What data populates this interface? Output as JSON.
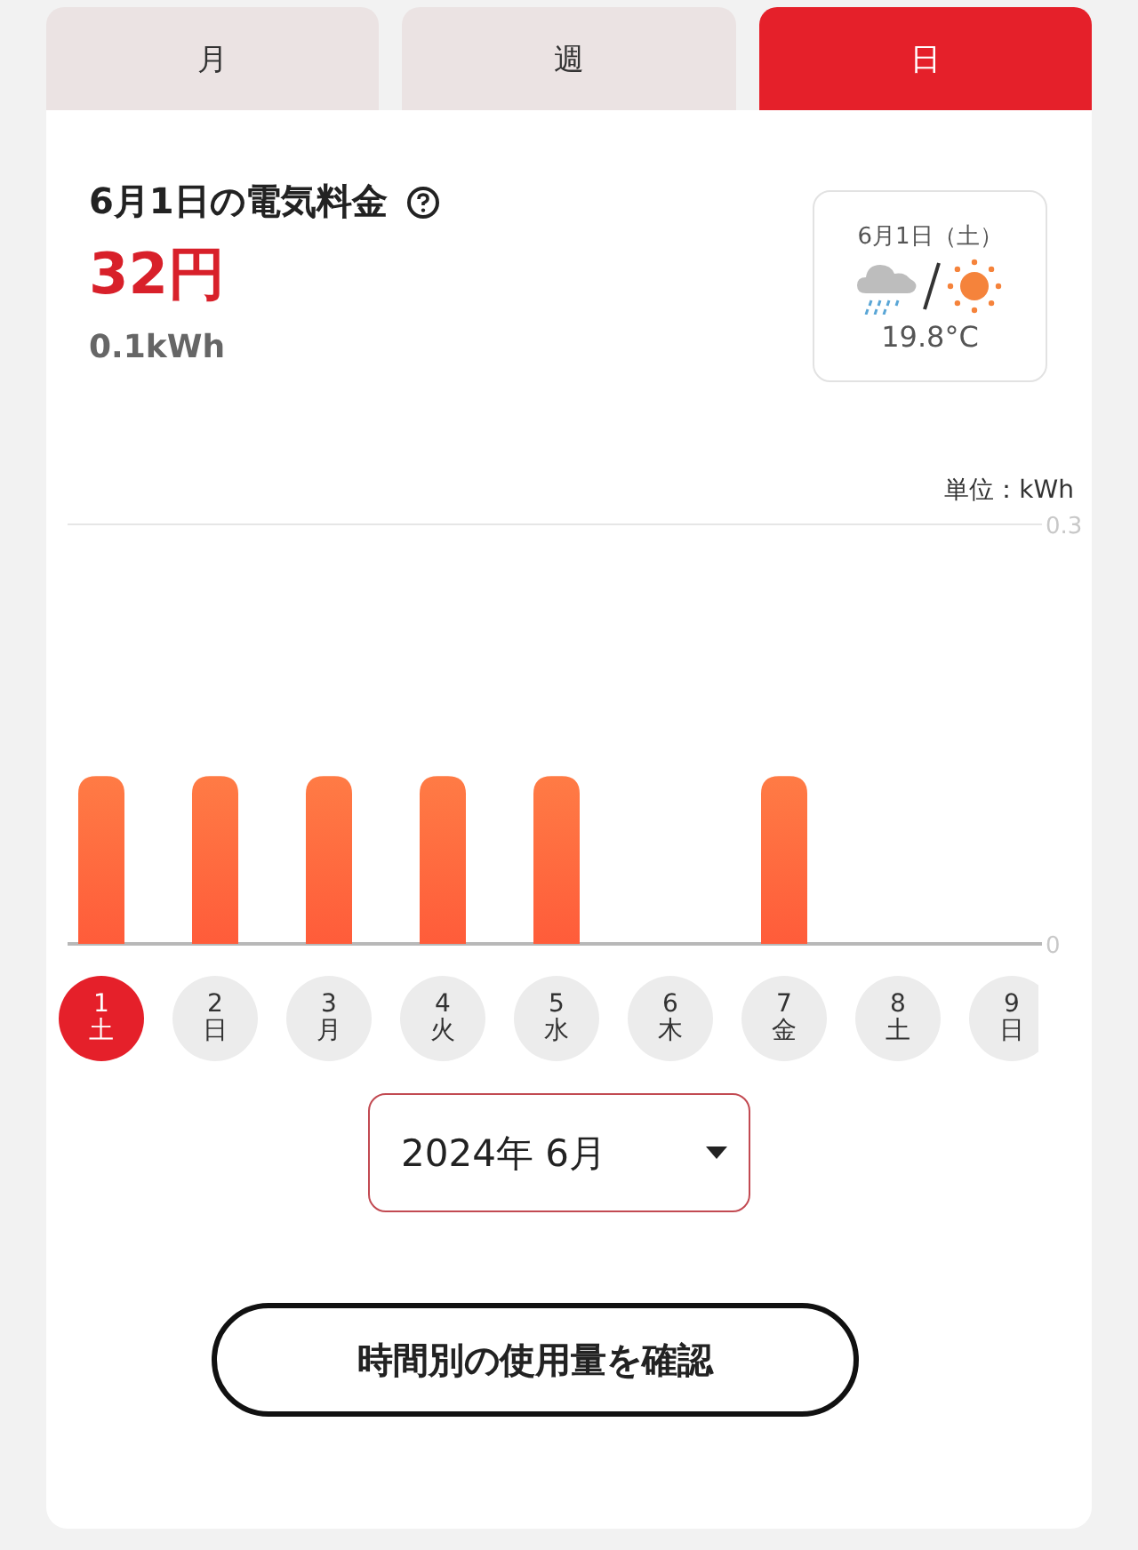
{
  "tabs": [
    {
      "label": "月",
      "selected": false
    },
    {
      "label": "週",
      "selected": false
    },
    {
      "label": "日",
      "selected": true
    }
  ],
  "summary": {
    "title": "6月1日の電気料金",
    "price": "32円",
    "usage": "0.1kWh"
  },
  "weather": {
    "date": "6月1日（土）",
    "conditions": [
      {
        "kind": "rain"
      },
      {
        "kind": "sun"
      }
    ],
    "temperature": "19.8°C"
  },
  "chart": {
    "unit": "単位：kWh",
    "chart_data": {
      "type": "bar",
      "values": [
        0.12,
        0.12,
        0.12,
        0.12,
        0.12,
        0,
        0.12,
        null,
        null
      ],
      "ylim": [
        0,
        0.3
      ],
      "yticks": [
        0,
        0.3
      ]
    }
  },
  "days": [
    {
      "day": "1",
      "weekday": "土",
      "selected": true
    },
    {
      "day": "2",
      "weekday": "日",
      "selected": false
    },
    {
      "day": "3",
      "weekday": "月",
      "selected": false
    },
    {
      "day": "4",
      "weekday": "火",
      "selected": false
    },
    {
      "day": "5",
      "weekday": "水",
      "selected": false
    },
    {
      "day": "6",
      "weekday": "木",
      "selected": false
    },
    {
      "day": "7",
      "weekday": "金",
      "selected": false
    },
    {
      "day": "8",
      "weekday": "土",
      "selected": false
    },
    {
      "day": "9",
      "weekday": "日",
      "selected": false
    }
  ],
  "month_select": {
    "value": "2024年 6月"
  },
  "hourly_button": "時間別の使用量を確認"
}
